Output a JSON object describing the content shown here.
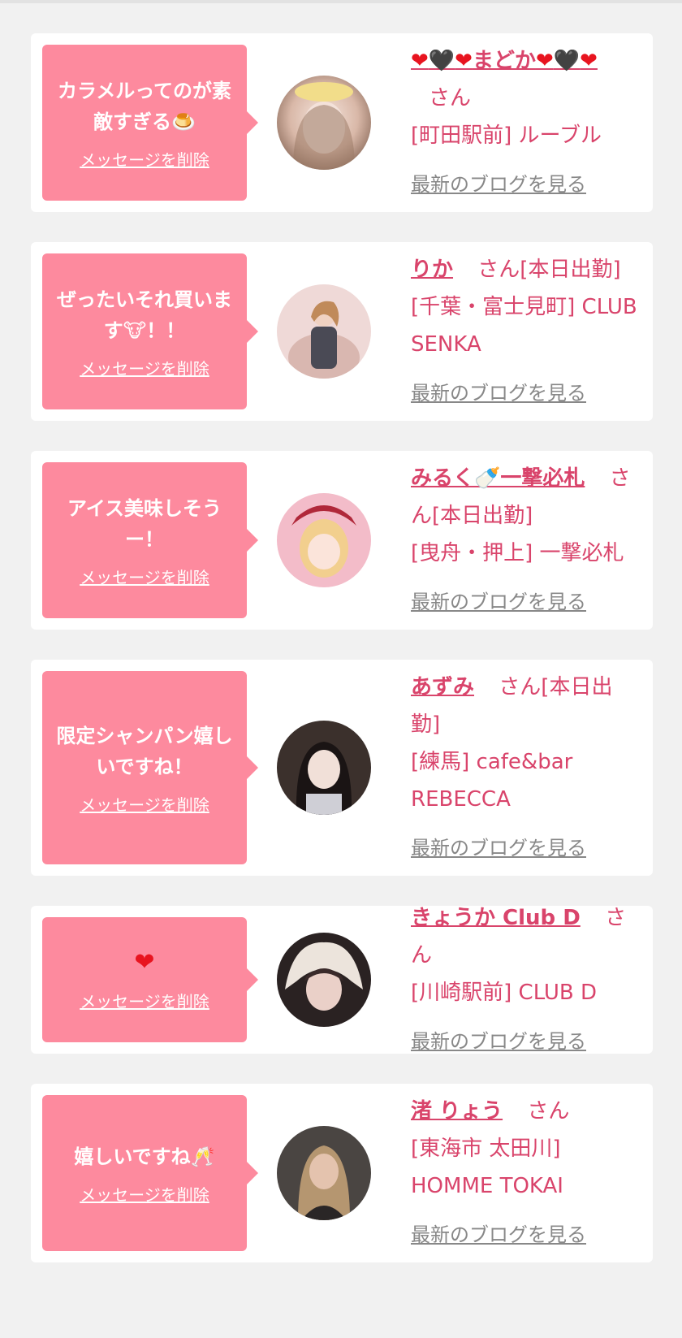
{
  "delete_label": "メッセージを削除",
  "blog_label": "最新のブログを見る",
  "san_label": "さん",
  "items": [
    {
      "message": "カラメルってのが素敵すぎる",
      "emoji": "🍮",
      "name": "❤🖤❤まどか❤🖤❤",
      "status": "",
      "shop": "[町田駅前] ルーブル"
    },
    {
      "message": "ぜったいそれ買います",
      "emoji": "🐮",
      "message_suffix": "！！",
      "name": "りか",
      "status": "[本日出勤]",
      "shop": "[千葉・富士見町] CLUB SENKA"
    },
    {
      "message": "アイス美味しそうー！",
      "name": "みるく🍼一撃必札",
      "status": "[本日出勤]",
      "shop": "[曳舟・押上] 一撃必札"
    },
    {
      "message": "限定シャンパン嬉しいですね！",
      "name": "あずみ",
      "status": "[本日出勤]",
      "shop": "[練馬] cafe&bar REBECCA"
    },
    {
      "message": "❤",
      "name": "きょうか Club D",
      "status": "",
      "shop": "[川崎駅前] CLUB D"
    },
    {
      "message": "嬉しいですね",
      "emoji": "🥂",
      "name": "渚 りょう",
      "status": "",
      "shop": "[東海市 太田川] HOMME TOKAI"
    }
  ],
  "colors": {
    "page_bg": "#f1f1f1",
    "card_bg": "#ffffff",
    "bubble_bg": "#fd8a9e",
    "accent_text": "#d9446b",
    "link_gray": "#888888",
    "heart_red": "#e8141f"
  }
}
